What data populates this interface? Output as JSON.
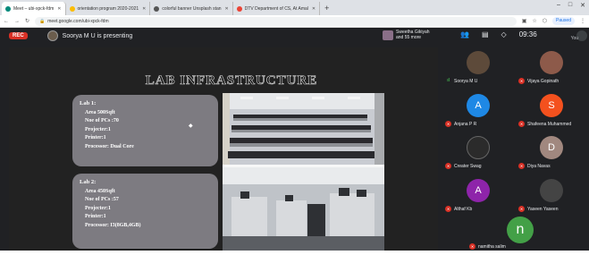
{
  "browser": {
    "tabs": [
      {
        "label": "Meet – ubi-xpck-fdm",
        "active": true,
        "favicon_color": "#00897b"
      },
      {
        "label": "orientation program 2020-2021",
        "active": false,
        "favicon_color": "#fbbc04"
      },
      {
        "label": "colorful banner Unsplash stan",
        "active": false,
        "favicon_color": "#555555"
      },
      {
        "label": "DTV Department of CS, At Amal",
        "active": false,
        "favicon_color": "#ea4335"
      }
    ],
    "new_tab": "+",
    "window_buttons": [
      "–",
      "□",
      "✕"
    ],
    "url": "meet.google.com/ubi-xpck-fdm",
    "paused_label": "Paused"
  },
  "meet": {
    "rec_label": "REC",
    "presenting_text": "Soorya M U is presenting",
    "people_text_1": "Sweetha Gikiyah",
    "people_text_2": "and 55 more",
    "time": "09:36",
    "you_label": "You"
  },
  "slide": {
    "title": "LAB INFRASTRUCTURE",
    "lab1": {
      "heading": "Lab 1:",
      "lines": [
        "Area 500Sqft",
        "Noe of PCs :70",
        "Projecter:1",
        "Printer:1",
        "Processor: Dual Core"
      ]
    },
    "lab2": {
      "heading": "Lab 2:",
      "lines": [
        "Area 450Sqft",
        "Noe of PCs :57",
        "Projecter:1",
        "Printer:1",
        "Processor: I3(8GB,4GB)"
      ]
    }
  },
  "participants": [
    {
      "name": "Soorya M U",
      "initial": "",
      "color": "#5d4a3a",
      "mic": "speaking"
    },
    {
      "name": "Vijaya Gopinath",
      "initial": "",
      "color": "#8d5a4a",
      "mic": "muted"
    },
    {
      "name": "Anjana P R",
      "initial": "A",
      "color": "#1e88e5",
      "mic": "muted"
    },
    {
      "name": "Shafeena Muhammed",
      "initial": "S",
      "color": "#f4511e",
      "mic": "muted"
    },
    {
      "name": "Creater Swag",
      "initial": "",
      "color": "#2b2b2b",
      "mic": "muted"
    },
    {
      "name": "Diya Navas",
      "initial": "D",
      "color": "#a1887f",
      "mic": "muted"
    },
    {
      "name": "Althaf Kb",
      "initial": "A",
      "color": "#8e24aa",
      "mic": "muted"
    },
    {
      "name": "Yaseen Yaseen",
      "initial": "",
      "color": "#444444",
      "mic": "muted"
    },
    {
      "name": "namitha salim",
      "initial": "n",
      "color": "#43a047",
      "mic": "muted"
    }
  ]
}
